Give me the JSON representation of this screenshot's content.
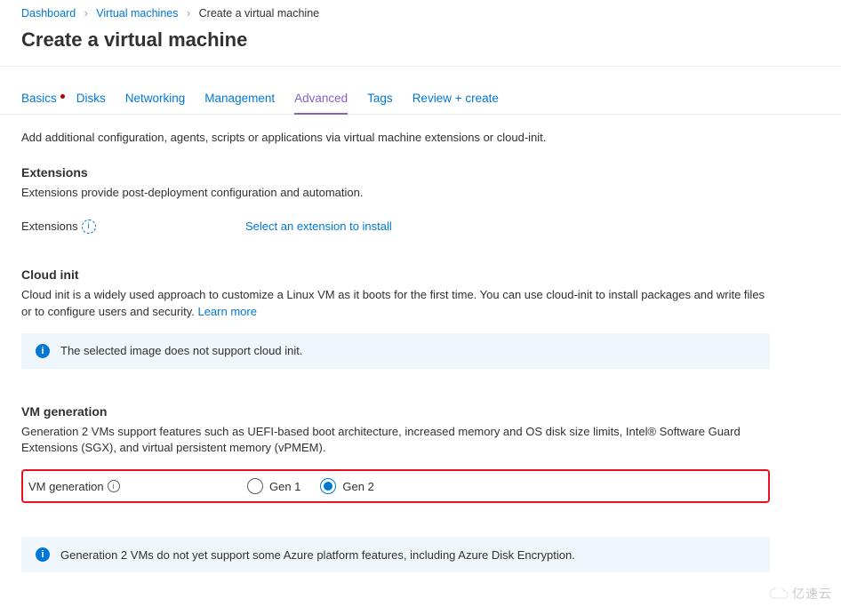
{
  "breadcrumb": {
    "items": [
      {
        "label": "Dashboard"
      },
      {
        "label": "Virtual machines"
      }
    ],
    "current": "Create a virtual machine"
  },
  "page_title": "Create a virtual machine",
  "tabs": {
    "basics": "Basics",
    "disks": "Disks",
    "networking": "Networking",
    "management": "Management",
    "advanced": "Advanced",
    "tags": "Tags",
    "review": "Review + create"
  },
  "intro": "Add additional configuration, agents, scripts or applications via virtual machine extensions or cloud-init.",
  "extensions": {
    "heading": "Extensions",
    "desc": "Extensions provide post-deployment configuration and automation.",
    "label": "Extensions",
    "select_link": "Select an extension to install"
  },
  "cloudinit": {
    "heading": "Cloud init",
    "desc": "Cloud init is a widely used approach to customize a Linux VM as it boots for the first time. You can use cloud-init to install packages and write files or to configure users and security.  ",
    "learn_more": "Learn more",
    "callout": "The selected image does not support cloud init."
  },
  "vmgen": {
    "heading": "VM generation",
    "desc": "Generation 2 VMs support features such as UEFI-based boot architecture, increased memory and OS disk size limits, Intel® Software Guard Extensions (SGX), and virtual persistent memory (vPMEM).",
    "label": "VM generation",
    "option1": "Gen 1",
    "option2": "Gen 2",
    "selected": "Gen 2",
    "callout": "Generation 2 VMs do not yet support some Azure platform features, including Azure Disk Encryption."
  },
  "watermark": "亿速云"
}
